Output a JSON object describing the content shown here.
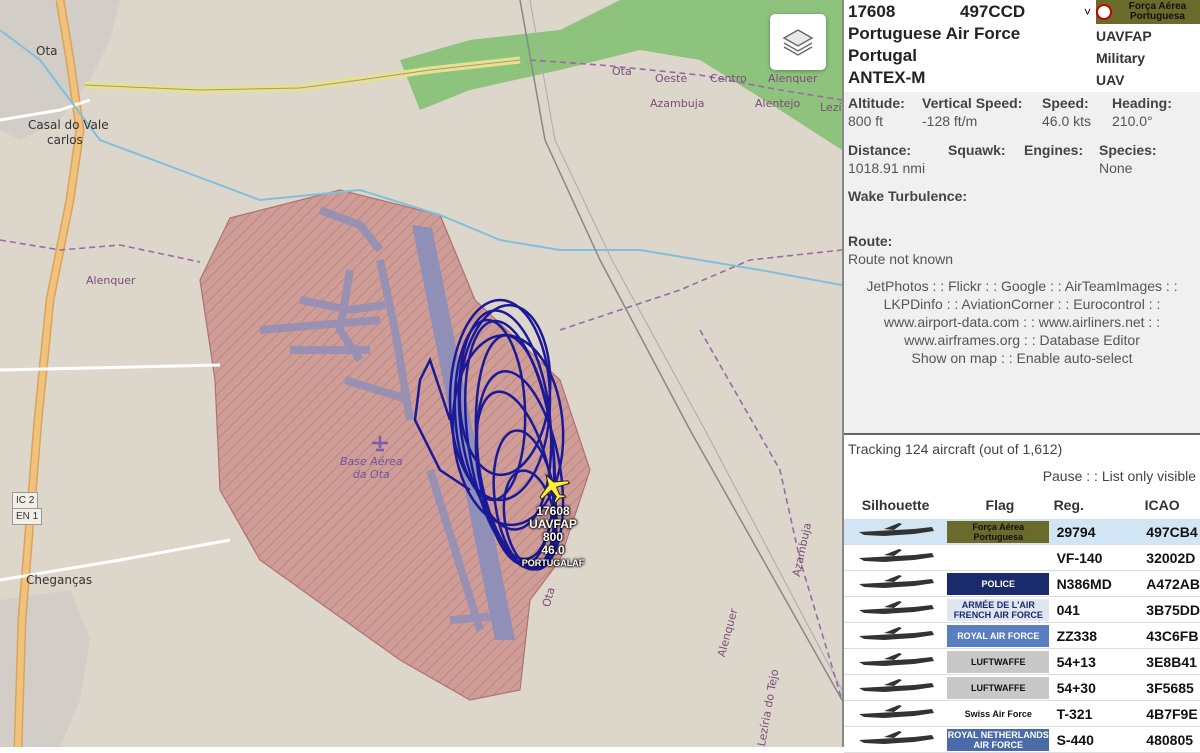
{
  "map": {
    "places": {
      "ota": "Ota",
      "casal": "Casal do Vale",
      "carlos": "carlos",
      "alenquer_w": "Alenquer",
      "chegancas": "Cheganças",
      "base_line1": "Base Aérea",
      "base_line2": "da Ota",
      "ota_oeste": "Ota",
      "oeste": "Oeste",
      "centro": "Centro",
      "alenquer_n": "Alenquer",
      "azambuja_n": "Azambuja",
      "alentejo": "Alentejo",
      "lez": "Lezí",
      "alenquer_s": "Alenquer",
      "leziria": "Lezíria do Tejo",
      "azambuja_e": "Azambuja",
      "ota_s": "Ota"
    },
    "shields": {
      "ic2": "IC 2",
      "en1": "EN 1"
    },
    "aircraft_label": {
      "hex": "17608",
      "callsign": "UAVFAP",
      "altitude": "800",
      "speed": "46.0",
      "operator": "PORTUGALAF"
    },
    "icons": {
      "layers": "layers-icon",
      "airport": "airport-icon",
      "aircraft": "plane-icon"
    },
    "colors": {
      "track": "#1a1a99",
      "military_zone": "#c78f8a",
      "aircraft": "#ffee33"
    }
  },
  "selected": {
    "hex": "17608",
    "icao": "497CCD",
    "operator": "Portuguese Air Force",
    "country": "Portugal",
    "type": "ANTEX-M",
    "callsign": "UAVFAP",
    "category": "Military",
    "class": "UAV",
    "flag_text": "Força Aérea Portuguesa",
    "details": {
      "altitude_label": "Altitude:",
      "altitude": "800 ft",
      "vs_label": "Vertical Speed:",
      "vs": "-128 ft/m",
      "speed_label": "Speed:",
      "speed": "46.0 kts",
      "heading_label": "Heading:",
      "heading": "210.0°",
      "distance_label": "Distance:",
      "distance": "1018.91 nmi",
      "squawk_label": "Squawk:",
      "engines_label": "Engines:",
      "species_label": "Species:",
      "species": "None",
      "wake_label": "Wake Turbulence:",
      "route_label": "Route:",
      "route": "Route not known"
    },
    "links": {
      "line1": "JetPhotos : : Flickr : : Google : : AirTeamImages : :",
      "line2": "LKPDinfo : : AviationCorner : : Eurocontrol : :",
      "line3": "www.airport-data.com : : www.airliners.net : :",
      "line4": "www.airframes.org : : Database Editor",
      "line5": "Show on map : : Enable auto-select"
    }
  },
  "list": {
    "tracking": "Tracking 124 aircraft (out of 1,612)",
    "pause": "Pause",
    "sep": " : : ",
    "only_visible": "List only visible",
    "headers": {
      "silhouette": "Silhouette",
      "flag": "Flag",
      "reg": "Reg.",
      "icao": "ICAO"
    },
    "rows": [
      {
        "reg": "29794",
        "icao": "497CB4",
        "flag": "Força Aérea Portuguesa"
      },
      {
        "reg": "VF-140",
        "icao": "32002D",
        "flag": ""
      },
      {
        "reg": "N386MD",
        "icao": "A472AB",
        "flag": "POLICE"
      },
      {
        "reg": "041",
        "icao": "3B75DD",
        "flag": "ARMÉE DE L'AIR FRENCH AIR FORCE"
      },
      {
        "reg": "ZZ338",
        "icao": "43C6FB",
        "flag": "ROYAL AIR FORCE"
      },
      {
        "reg": "54+13",
        "icao": "3E8B41",
        "flag": "LUFTWAFFE"
      },
      {
        "reg": "54+30",
        "icao": "3F5685",
        "flag": "LUFTWAFFE"
      },
      {
        "reg": "T-321",
        "icao": "4B7F9E",
        "flag": "Swiss Air Force"
      },
      {
        "reg": "S-440",
        "icao": "480805",
        "flag": "ROYAL NETHERLANDS AIR FORCE"
      }
    ]
  }
}
